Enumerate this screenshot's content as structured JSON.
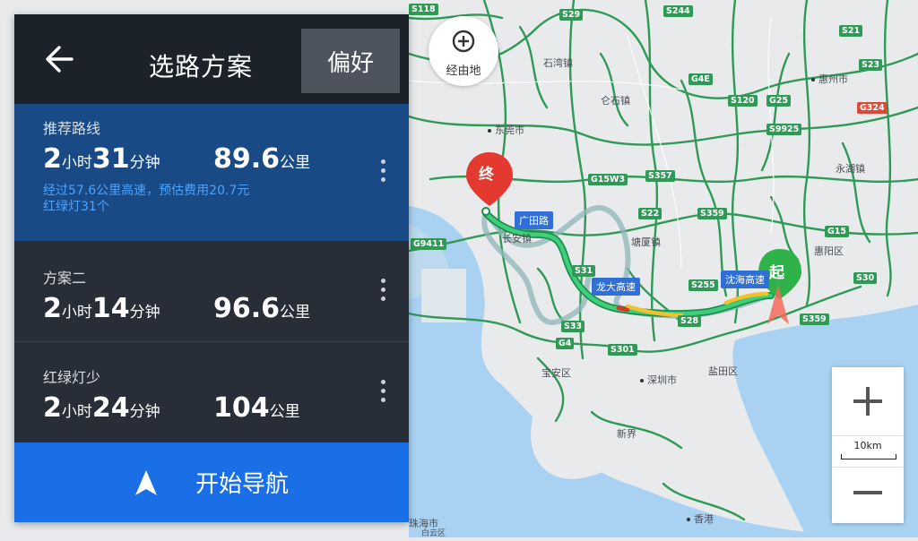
{
  "header": {
    "title": "选路方案",
    "preference_label": "偏好"
  },
  "routes": [
    {
      "name": "推荐路线",
      "hours": "2",
      "hour_unit": "小时",
      "minutes": "31",
      "minute_unit": "分钟",
      "distance": "89.6",
      "distance_unit": "公里",
      "desc_line1": "经过57.6公里高速，预估费用20.7元",
      "desc_line2": "红绿灯31个"
    },
    {
      "name": "方案二",
      "hours": "2",
      "hour_unit": "小时",
      "minutes": "14",
      "minute_unit": "分钟",
      "distance": "96.6",
      "distance_unit": "公里"
    },
    {
      "name": "红绿灯少",
      "hours": "2",
      "hour_unit": "小时",
      "minutes": "24",
      "minute_unit": "分钟",
      "distance": "104",
      "distance_unit": "公里"
    }
  ],
  "start_nav_label": "开始导航",
  "waypoint_label": "经由地",
  "scale_label": "10km",
  "markers": {
    "end": "终",
    "start": "起"
  },
  "map_labels": {
    "places": [
      "东莞市",
      "惠州市",
      "深圳市",
      "香港",
      "石湾镇",
      "仑石镇",
      "塘厦镇",
      "永湖镇",
      "惠阳区",
      "宝安区",
      "盐田区",
      "新界",
      "珠海市",
      "长安镇",
      "白云区"
    ],
    "roadtags": [
      "广田路",
      "龙大高速",
      "沈海高速"
    ],
    "shields": [
      "S118",
      "S29",
      "S244",
      "S21",
      "S23",
      "G4E",
      "S120",
      "G25",
      "G324",
      "S9925",
      "G15W3",
      "S357",
      "S22",
      "S359",
      "G9411",
      "S31",
      "S255",
      "G15",
      "S30",
      "S33",
      "S28",
      "G4",
      "S301",
      "S359"
    ]
  },
  "colors": {
    "accent": "#1a6ee6",
    "selected_route": "#1a4a86",
    "panel": "#272e38",
    "header": "#1c222a",
    "road_green": "#2f9a55",
    "water": "#a9d2f2"
  },
  "icons": {
    "back": "arrow-left-icon",
    "kebab": "more-vertical-icon",
    "nav": "navigation-arrow-icon",
    "waypoint": "plus-circle-icon",
    "zoom_in": "plus-icon",
    "zoom_out": "minus-icon"
  }
}
